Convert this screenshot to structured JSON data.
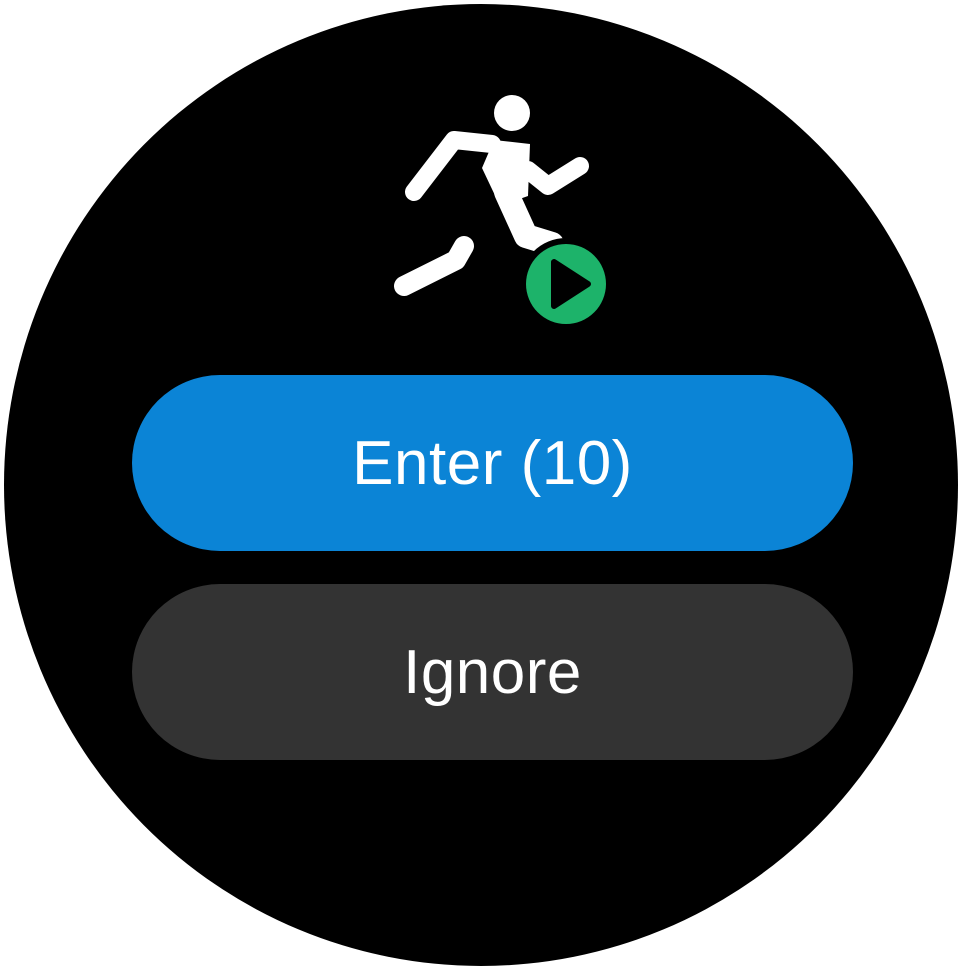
{
  "screen": {
    "background_color": "#000000"
  },
  "icon": {
    "name": "running-workout-icon",
    "badge": "play-icon",
    "figure_color": "#ffffff",
    "badge_color": "#1db36a"
  },
  "buttons": {
    "enter_label": "Enter (10)",
    "enter_color": "#0b84d6",
    "ignore_label": "Ignore",
    "ignore_color": "#333333"
  }
}
